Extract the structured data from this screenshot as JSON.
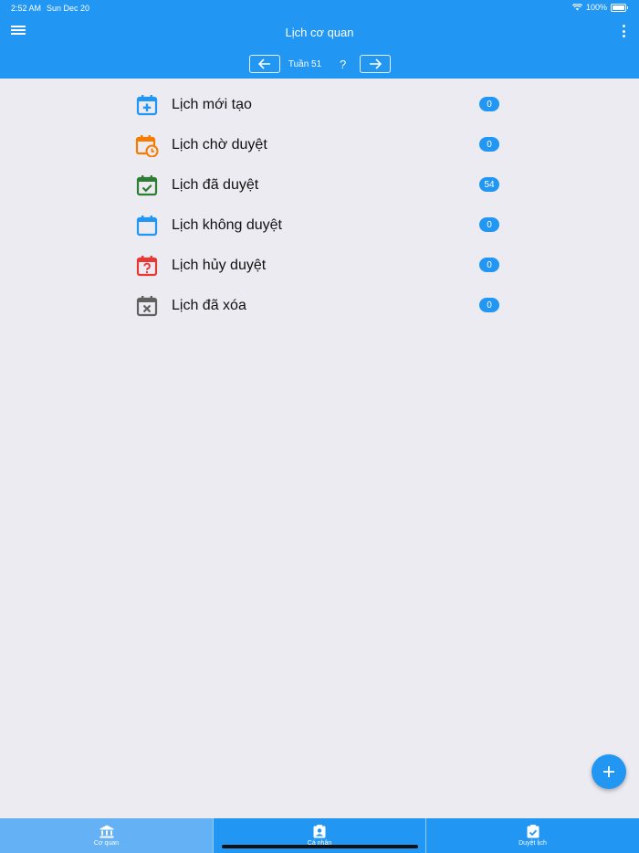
{
  "status_bar": {
    "time": "2:52 AM",
    "date": "Sun Dec 20",
    "battery": "100%"
  },
  "app_bar": {
    "title": "Lịch cơ quan",
    "week_label": "Tuần 51",
    "help": "?"
  },
  "items": [
    {
      "label": "Lịch mới tạo",
      "count": "0",
      "icon": "calendar-plus-icon",
      "color": "#2196F3"
    },
    {
      "label": "Lịch chờ duyệt",
      "count": "0",
      "icon": "calendar-clock-icon",
      "color": "#F57C00"
    },
    {
      "label": "Lịch đã duyệt",
      "count": "54",
      "icon": "calendar-check-icon",
      "color": "#2E7D32"
    },
    {
      "label": "Lịch không duyệt",
      "count": "0",
      "icon": "calendar-blank-icon",
      "color": "#2196F3"
    },
    {
      "label": "Lịch hủy duyệt",
      "count": "0",
      "icon": "calendar-question-icon",
      "color": "#E53935"
    },
    {
      "label": "Lịch đã xóa",
      "count": "0",
      "icon": "calendar-remove-icon",
      "color": "#616161"
    }
  ],
  "tabs": [
    {
      "label": "Cơ quan",
      "icon": "bank-icon",
      "active": true
    },
    {
      "label": "Cá nhân",
      "icon": "contact-card-icon",
      "active": false
    },
    {
      "label": "Duyệt lịch",
      "icon": "clipboard-check-icon",
      "active": false
    }
  ],
  "colors": {
    "primary": "#2196F3",
    "background": "#ECEBF1",
    "active_tab": "#64B1F5"
  }
}
